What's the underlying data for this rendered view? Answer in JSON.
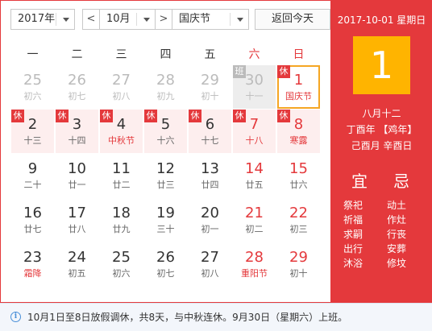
{
  "toolbar": {
    "year": "2017年",
    "prev": "<",
    "month": "10月",
    "next": ">",
    "holiday": "国庆节",
    "today_button": "返回今天"
  },
  "weekdays": [
    "一",
    "二",
    "三",
    "四",
    "五",
    "六",
    "日"
  ],
  "days": [
    {
      "d": "25",
      "l": "初六",
      "style": "other"
    },
    {
      "d": "26",
      "l": "初七",
      "style": "other"
    },
    {
      "d": "27",
      "l": "初八",
      "style": "other"
    },
    {
      "d": "28",
      "l": "初九",
      "style": "other"
    },
    {
      "d": "29",
      "l": "初十",
      "style": "other"
    },
    {
      "d": "30",
      "l": "十一",
      "style": "other-work",
      "badge": "班"
    },
    {
      "d": "1",
      "l": "国庆节",
      "style": "selected",
      "badge": "休",
      "red": true
    },
    {
      "d": "2",
      "l": "十三",
      "style": "holiday",
      "badge": "休"
    },
    {
      "d": "3",
      "l": "十四",
      "style": "holiday",
      "badge": "休"
    },
    {
      "d": "4",
      "l": "中秋节",
      "style": "holiday",
      "badge": "休",
      "lred": true
    },
    {
      "d": "5",
      "l": "十六",
      "style": "holiday",
      "badge": "休"
    },
    {
      "d": "6",
      "l": "十七",
      "style": "holiday",
      "badge": "休"
    },
    {
      "d": "7",
      "l": "十八",
      "style": "holiday",
      "badge": "休",
      "red": true
    },
    {
      "d": "8",
      "l": "寒露",
      "style": "holiday",
      "badge": "休",
      "red": true
    },
    {
      "d": "9",
      "l": "二十"
    },
    {
      "d": "10",
      "l": "廿一"
    },
    {
      "d": "11",
      "l": "廿二"
    },
    {
      "d": "12",
      "l": "廿三"
    },
    {
      "d": "13",
      "l": "廿四"
    },
    {
      "d": "14",
      "l": "廿五",
      "red": true,
      "lplain": true
    },
    {
      "d": "15",
      "l": "廿六",
      "red": true,
      "lplain": true
    },
    {
      "d": "16",
      "l": "廿七"
    },
    {
      "d": "17",
      "l": "廿八"
    },
    {
      "d": "18",
      "l": "廿九"
    },
    {
      "d": "19",
      "l": "三十"
    },
    {
      "d": "20",
      "l": "初一"
    },
    {
      "d": "21",
      "l": "初二",
      "red": true,
      "lplain": true
    },
    {
      "d": "22",
      "l": "初三",
      "red": true,
      "lplain": true
    },
    {
      "d": "23",
      "l": "霜降",
      "lred": true
    },
    {
      "d": "24",
      "l": "初五"
    },
    {
      "d": "25",
      "l": "初六"
    },
    {
      "d": "26",
      "l": "初七"
    },
    {
      "d": "27",
      "l": "初八"
    },
    {
      "d": "28",
      "l": "重阳节",
      "red": true
    },
    {
      "d": "29",
      "l": "初十",
      "red": true,
      "lplain": true
    }
  ],
  "panel": {
    "date_line": "2017-10-01 星期日",
    "big_day": "1",
    "lunar_month_day": "八月十二",
    "ganzhi_year": "丁酉年 【鸡年】",
    "ganzhi_month_day": "己酉月 辛酉日",
    "yi_title": "宜",
    "ji_title": "忌",
    "yi": [
      "祭祀",
      "祈福",
      "求嗣",
      "出行",
      "沐浴"
    ],
    "ji": [
      "动土",
      "作灶",
      "行丧",
      "安葬",
      "修坟"
    ]
  },
  "notice": "10月1日至8日放假调休，共8天，与中秋连休。9月30日（星期六）上班。",
  "colors": {
    "accent": "#e4393c",
    "highlight": "#ffb400",
    "selected_border": "#f5a623"
  }
}
